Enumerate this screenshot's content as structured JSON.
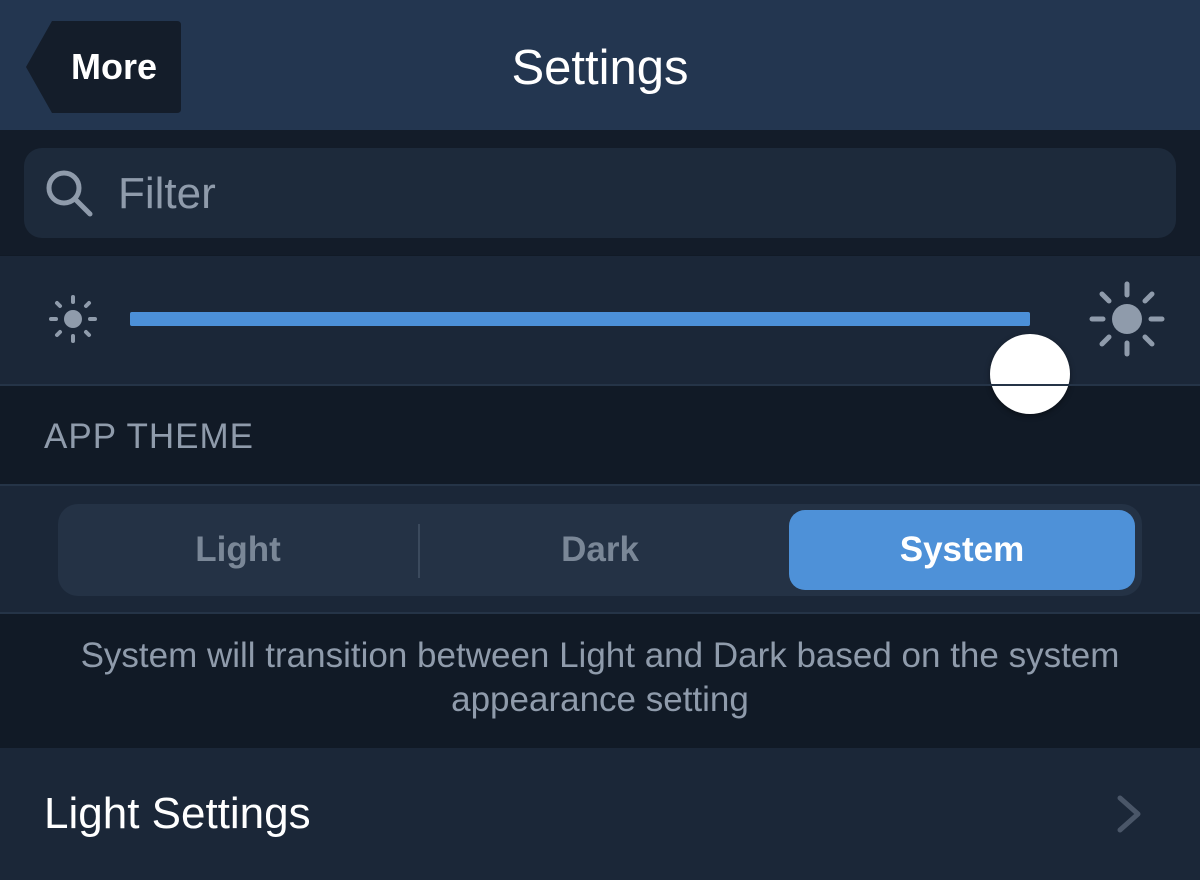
{
  "nav": {
    "back_label": "More",
    "title": "Settings"
  },
  "search": {
    "placeholder": "Filter",
    "value": ""
  },
  "brightness": {
    "value": 1.0,
    "min_icon": "sun-small-icon",
    "max_icon": "sun-large-icon"
  },
  "app_theme": {
    "header": "APP THEME",
    "options": [
      "Light",
      "Dark",
      "System"
    ],
    "selected": "System",
    "description": "System will transition between Light and Dark based on the system appearance setting"
  },
  "cells": [
    {
      "label": "Light Settings",
      "icon": "chevron-right-icon"
    }
  ],
  "colors": {
    "accent": "#4e91d8",
    "nav_bg": "#233650",
    "bg": "#111a26",
    "cell_bg": "#1b2738"
  }
}
